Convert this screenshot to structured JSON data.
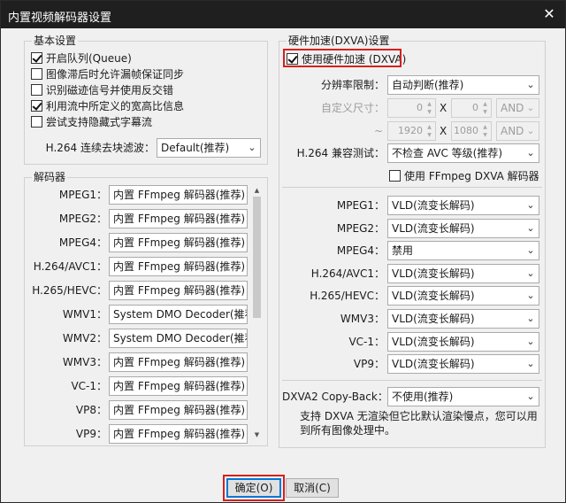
{
  "window": {
    "title": "内置视频解码器设置",
    "close_glyph": "✕"
  },
  "basic": {
    "title": "基本设置",
    "options": [
      {
        "label": "开启队列(Queue)",
        "checked": true
      },
      {
        "label": "图像滞后时允许漏帧保证同步",
        "checked": false
      },
      {
        "label": "识别磁迹信号并使用反交错",
        "checked": false
      },
      {
        "label": "利用流中所定义的宽高比信息",
        "checked": true
      },
      {
        "label": "尝试支持隐藏式字幕流",
        "checked": false
      }
    ],
    "deblock_label": "H.264 连续去块滤波：",
    "deblock_value": "Default(推荐)"
  },
  "decoders": {
    "title": "解码器",
    "rows": [
      {
        "label": "MPEG1：",
        "value": "内置 FFmpeg 解码器(推荐)"
      },
      {
        "label": "MPEG2：",
        "value": "内置 FFmpeg 解码器(推荐)"
      },
      {
        "label": "MPEG4：",
        "value": "内置 FFmpeg 解码器(推荐)"
      },
      {
        "label": "H.264/AVC1：",
        "value": "内置 FFmpeg 解码器(推荐)"
      },
      {
        "label": "H.265/HEVC：",
        "value": "内置 FFmpeg 解码器(推荐)"
      },
      {
        "label": "WMV1：",
        "value": "System DMO Decoder(推荐)"
      },
      {
        "label": "WMV2：",
        "value": "System DMO Decoder(推荐)"
      },
      {
        "label": "WMV3：",
        "value": "内置 FFmpeg 解码器(推荐)"
      },
      {
        "label": "VC-1：",
        "value": "内置 FFmpeg 解码器(推荐)"
      },
      {
        "label": "VP8：",
        "value": "内置 FFmpeg 解码器(推荐)"
      },
      {
        "label": "VP9：",
        "value": "内置 FFmpeg 解码器(推荐)"
      }
    ]
  },
  "hw": {
    "title": "硬件加速(DXVA)设置",
    "enable_label": "使用硬件加速 (DXVA)",
    "enable_checked": true,
    "resolution_label": "分辨率限制：",
    "resolution_value": "自动判断(推荐)",
    "custom_label": "自定义尺寸：",
    "w1": "0",
    "h1": "0",
    "op1": "AND",
    "tilde": "~",
    "w2": "1920",
    "h2": "1080",
    "op2": "AND",
    "x_sep": "X",
    "compat_label": "H.264 兼容测试：",
    "compat_value": "不检查 AVC 等级(推荐)",
    "ffmpeg_dxva_label": "使用 FFmpeg DXVA 解码器",
    "ffmpeg_dxva_checked": false,
    "rows": [
      {
        "label": "MPEG1：",
        "value": "VLD(流变长解码)"
      },
      {
        "label": "MPEG2：",
        "value": "VLD(流变长解码)"
      },
      {
        "label": "MPEG4：",
        "value": "禁用"
      },
      {
        "label": "H.264/AVC1：",
        "value": "VLD(流变长解码)"
      },
      {
        "label": "H.265/HEVC：",
        "value": "VLD(流变长解码)"
      },
      {
        "label": "WMV3：",
        "value": "VLD(流变长解码)"
      },
      {
        "label": "VC-1：",
        "value": "VLD(流变长解码)"
      },
      {
        "label": "VP9：",
        "value": "VLD(流变长解码)"
      }
    ],
    "copyback_label": "DXVA2 Copy-Back：",
    "copyback_value": "不使用(推荐)",
    "note": "支持 DXVA 无渲染但它比默认渲染慢点，您可以用到所有图像处理中。"
  },
  "buttons": {
    "ok": "确定(O)",
    "cancel": "取消(C)"
  },
  "colors": {
    "highlight": "#d61f1f",
    "titlebar": "#1f1f1f"
  }
}
